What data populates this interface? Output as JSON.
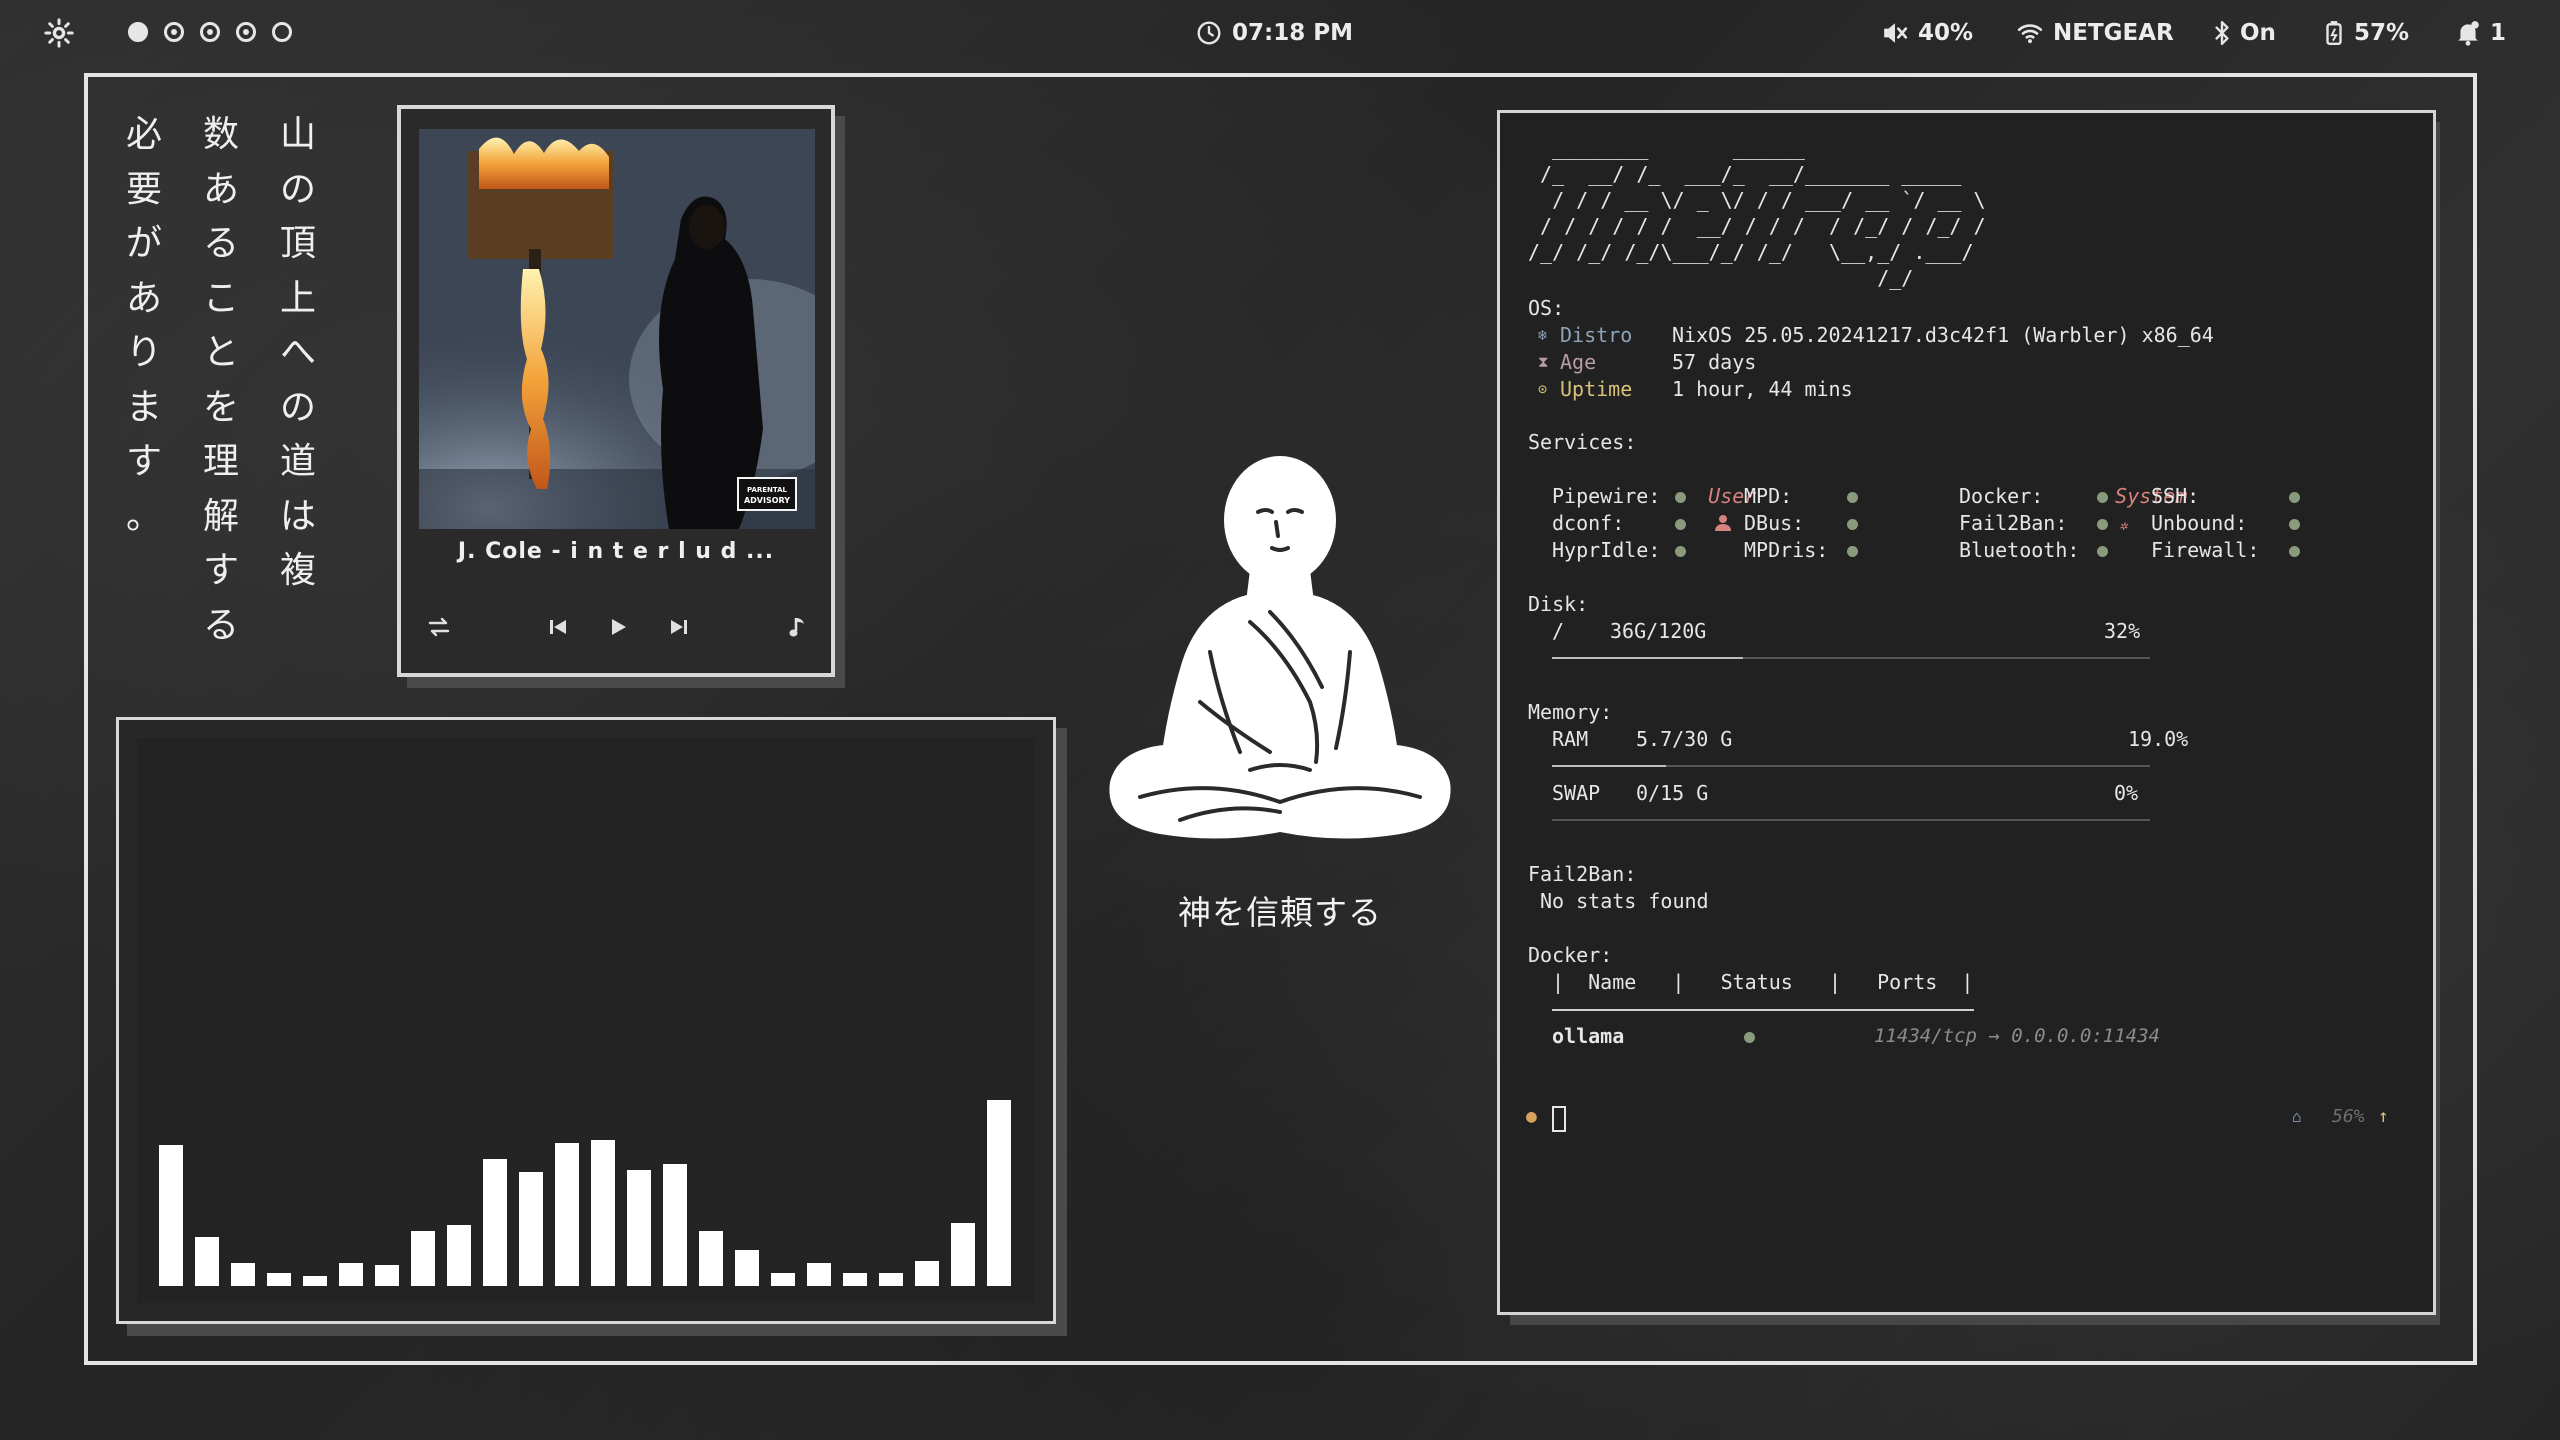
{
  "topbar": {
    "time": "07:18 PM",
    "volume": "40%",
    "wifi": "NETGEAR",
    "bluetooth": "On",
    "battery": "57%",
    "notifications": "1",
    "workspaces": [
      "active",
      "occupied",
      "occupied",
      "occupied",
      "empty"
    ]
  },
  "vertical_text": {
    "col_right": [
      "山",
      "の",
      "頂",
      "上",
      "へ",
      "の",
      "道",
      "は",
      "複"
    ],
    "col_middle": [
      "数",
      "あ",
      "る",
      "こ",
      "と",
      "を",
      "理",
      "解",
      "す",
      "る"
    ],
    "col_left": [
      "必",
      "要",
      "が",
      "あ",
      "り",
      "ま",
      "す",
      "。"
    ]
  },
  "player": {
    "track": "J. Cole - i n t e r l u d ...",
    "cover_sticker": "PARENTAL ADVISORY"
  },
  "visualizer": {
    "levels": [
      0.74,
      0.26,
      0.12,
      0.07,
      0.05,
      0.12,
      0.11,
      0.29,
      0.32,
      0.67,
      0.6,
      0.75,
      0.77,
      0.61,
      0.64,
      0.29,
      0.19,
      0.07,
      0.12,
      0.07,
      0.07,
      0.13,
      0.33,
      0.98
    ]
  },
  "monk": {
    "caption": "神を信頼する"
  },
  "terminal": {
    "ascii": [
      "  ________       ______",
      " /_  __/ /_  ___/_  __/_______ _____",
      "  / / / __ \\/ _ \\/ / / ___/ __ `/ __ \\",
      " / / / / / /  __/ / / /  / /_/ / /_/ /",
      "/_/ /_/ /_/\\___/_/ /_/   \\__,_/ .___/",
      "                             /_/"
    ],
    "os_header": "OS:",
    "os": [
      {
        "icon": "snowflake-icon",
        "glyph": "❄",
        "label": "Distro",
        "value": "NixOS 25.05.20241217.d3c42f1 (Warbler) x86_64",
        "color": "#8fa3b8"
      },
      {
        "icon": "hourglass-icon",
        "glyph": "⧗",
        "label": "Age",
        "value": "57 days",
        "color": "#b99aa8"
      },
      {
        "icon": "clock-icon",
        "glyph": "⊙",
        "label": "Uptime",
        "value": "1 hour, 44 mins",
        "color": "#d8c27a"
      }
    ],
    "services_header": "Services:",
    "services_user_label": "User",
    "services_system_label": "System",
    "services": {
      "user_a": [
        "Pipewire:",
        "dconf:",
        "HyprIdle:"
      ],
      "user_b": [
        "MPD:",
        "DBus:",
        "MPDris:"
      ],
      "sys_a": [
        "Docker:",
        "Fail2Ban:",
        "Bluetooth:"
      ],
      "sys_b": [
        "SSH:",
        "Unbound:",
        "Firewall:"
      ]
    },
    "disk_header": "Disk:",
    "disk": {
      "mount": "/",
      "usage": "36G/120G",
      "percent": "32%",
      "fill": 0.32
    },
    "memory_header": "Memory:",
    "ram": {
      "label": "RAM",
      "usage": "5.7/30 G",
      "percent": "19.0%",
      "fill": 0.19
    },
    "swap": {
      "label": "SWAP",
      "usage": "0/15 G",
      "percent": "0%",
      "fill": 0.0
    },
    "fail2ban_header": "Fail2Ban:",
    "fail2ban_text": "No stats found",
    "docker_header": "Docker:",
    "docker_cols": "|  Name   |   Status   |   Ports  |",
    "docker_rows": [
      {
        "name": "ollama",
        "ports": "11434/tcp → 0.0.0.0:11434"
      }
    ],
    "prompt_right": "56%",
    "colors": {
      "user": "#d7827e",
      "system": "#d7827e",
      "dot": "#8a9a7c",
      "prompt": "#d6a25b",
      "accent": "#7a8fb0"
    }
  }
}
